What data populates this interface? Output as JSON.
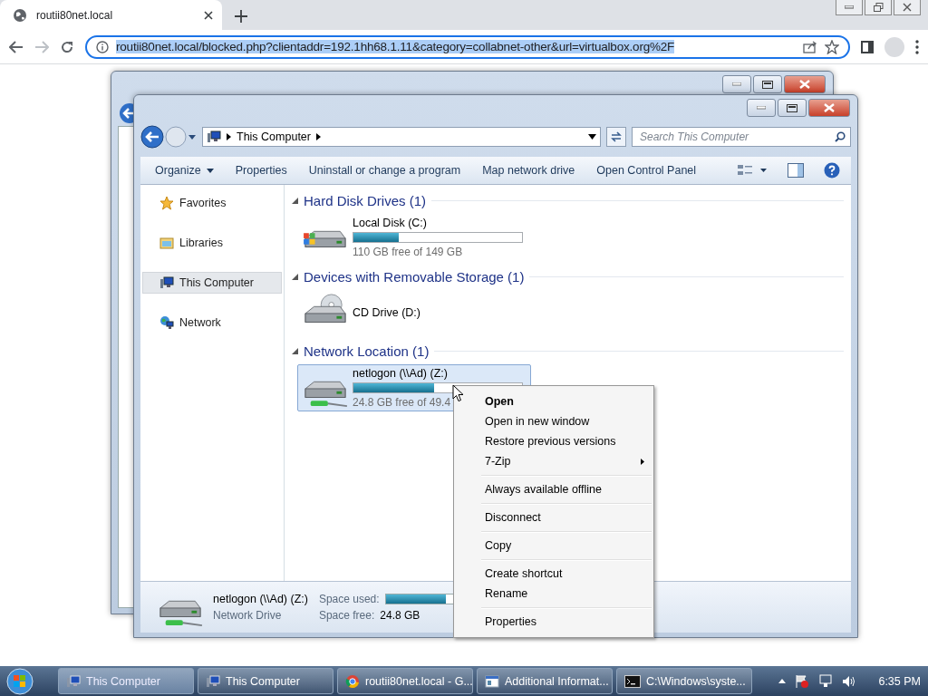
{
  "browser": {
    "tab_title": "routii80net.local",
    "url": "routii80net.local/blocked.php?clientaddr=192.1hh68.1.11&category=collabnet-other&url=virtualbox.org%2F"
  },
  "window": {
    "address": "This Computer",
    "search": {
      "placeholder": "Search This Computer"
    },
    "toolbar": [
      {
        "label": "Organize",
        "dropdown": true
      },
      {
        "label": "Properties",
        "dropdown": false
      },
      {
        "label": "Uninstall or change a program",
        "dropdown": false
      },
      {
        "label": "Map network drive",
        "dropdown": false
      },
      {
        "label": "Open Control Panel",
        "dropdown": false
      }
    ],
    "nav": [
      {
        "label": "Favorites",
        "kind": "star",
        "selected": false
      },
      {
        "label": "Libraries",
        "kind": "library",
        "selected": false
      },
      {
        "label": "This Computer",
        "kind": "computer",
        "selected": true
      },
      {
        "label": "Network",
        "kind": "network",
        "selected": false
      }
    ],
    "groups": [
      {
        "title": "Hard Disk Drives (1)",
        "expanded": true,
        "items": [
          {
            "name": "Local Disk (C:)",
            "kind": "disk",
            "level": 0.27,
            "detail": "110 GB free of 149 GB",
            "selected": false
          }
        ]
      },
      {
        "title": "Devices with Removable Storage (1)",
        "expanded": true,
        "items": [
          {
            "name": "CD Drive (D:)",
            "kind": "cd",
            "selected": false
          }
        ]
      },
      {
        "title": "Network Location (1)",
        "expanded": true,
        "items": [
          {
            "name": "netlogon (\\\\Ad) (Z:)",
            "kind": "network",
            "level": 0.48,
            "detail": "24.8 GB free of 49.4",
            "selected": true
          }
        ]
      }
    ],
    "details": {
      "name": "netlogon (\\\\Ad) (Z:)",
      "type": "Network Drive",
      "used_label": "Space used:",
      "level": 0.5,
      "free_label": "Space free:",
      "free": "24.8 GB"
    }
  },
  "context_menu": [
    [
      {
        "label": "Open",
        "bold": true,
        "submenu": false
      },
      {
        "label": "Open in new window",
        "bold": false,
        "submenu": false
      },
      {
        "label": "Restore previous versions",
        "bold": false,
        "submenu": false
      },
      {
        "label": "7-Zip",
        "bold": false,
        "submenu": true
      }
    ],
    [
      {
        "label": "Always available offline",
        "bold": false,
        "submenu": false
      }
    ],
    [
      {
        "label": "Disconnect",
        "bold": false,
        "submenu": false
      }
    ],
    [
      {
        "label": "Copy",
        "bold": false,
        "submenu": false
      }
    ],
    [
      {
        "label": "Create shortcut",
        "bold": false,
        "submenu": false
      },
      {
        "label": "Rename",
        "bold": false,
        "submenu": false
      }
    ],
    [
      {
        "label": "Properties",
        "bold": false,
        "submenu": false
      }
    ]
  ],
  "taskbar": {
    "items": [
      {
        "label": "This Computer",
        "kind": "explorer",
        "selected": true
      },
      {
        "label": "This Computer",
        "kind": "explorer",
        "selected": false
      },
      {
        "label": "routii80net.local - G...",
        "kind": "chrome",
        "selected": false
      },
      {
        "label": "Additional Informat...",
        "kind": "window",
        "selected": false
      },
      {
        "label": "C:\\Windows\\syste...",
        "kind": "console",
        "selected": false
      }
    ],
    "clock": "6:35 PM"
  }
}
